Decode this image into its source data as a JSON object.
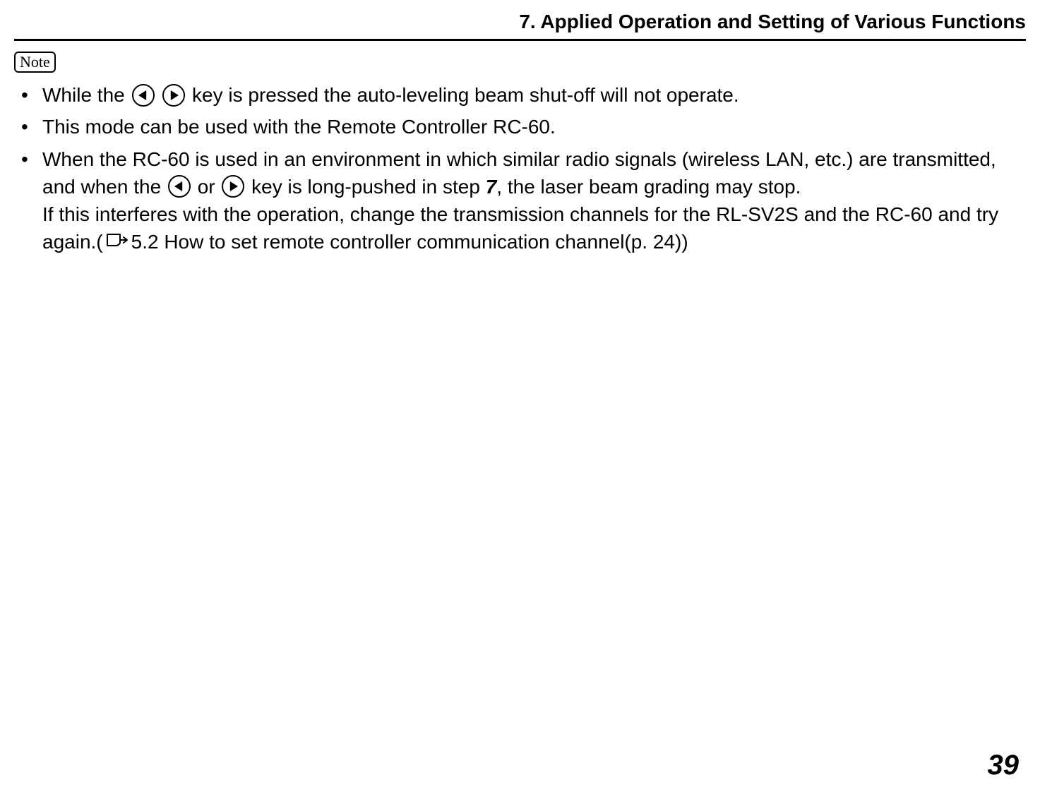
{
  "header": {
    "title": "7.  Applied Operation and Setting of Various Functions"
  },
  "note_label": "Note",
  "bullets": [
    {
      "segments": [
        {
          "t": "text",
          "v": "While the "
        },
        {
          "t": "key",
          "v": "left"
        },
        {
          "t": "text",
          "v": " "
        },
        {
          "t": "key",
          "v": "right"
        },
        {
          "t": "text",
          "v": " key is pressed the auto-leveling beam shut-off will not operate."
        }
      ]
    },
    {
      "segments": [
        {
          "t": "text",
          "v": "This mode can be used with the Remote Controller RC-60."
        }
      ]
    },
    {
      "segments": [
        {
          "t": "text",
          "v": "When the RC-60 is used in an environment in which similar radio signals (wireless LAN, etc.) are transmitted, and when the "
        },
        {
          "t": "key",
          "v": "left"
        },
        {
          "t": "text",
          "v": " or "
        },
        {
          "t": "key",
          "v": "right"
        },
        {
          "t": "text",
          "v": " key is long-pushed in step "
        },
        {
          "t": "bolditalic",
          "v": "7"
        },
        {
          "t": "text",
          "v": ", the laser beam grading may stop."
        },
        {
          "t": "br"
        },
        {
          "t": "text",
          "v": "If this interferes with the operation, change the transmission channels for the RL-SV2S and the RC-60 and try again.("
        },
        {
          "t": "cref"
        },
        {
          "t": "text",
          "v": "5.2 How to set remote controller communication channel(p. 24))"
        }
      ]
    }
  ],
  "page_number": "39",
  "icons": {
    "left": "left-arrow-key-icon",
    "right": "right-arrow-key-icon",
    "cref": "cross-reference-icon"
  }
}
